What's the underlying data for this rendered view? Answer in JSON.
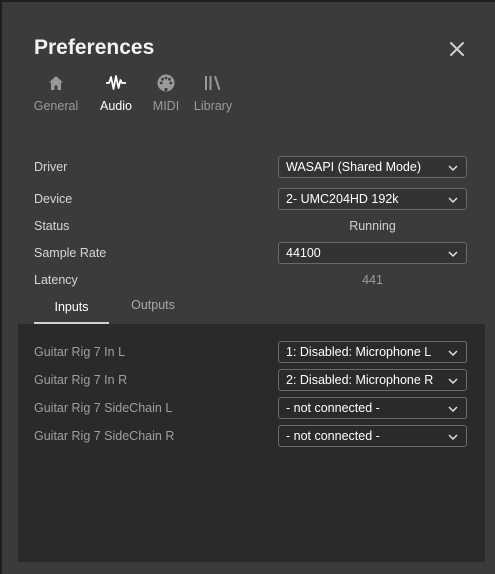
{
  "dialog": {
    "title": "Preferences"
  },
  "tabs": [
    {
      "label": "General",
      "icon": "home-icon",
      "active": false
    },
    {
      "label": "Audio",
      "icon": "waveform-icon",
      "active": true
    },
    {
      "label": "MIDI",
      "icon": "midi-connector-icon",
      "active": false
    },
    {
      "label": "Library",
      "icon": "library-icon",
      "active": false
    }
  ],
  "audio": {
    "driver": {
      "label": "Driver",
      "value": "WASAPI (Shared Mode)"
    },
    "device": {
      "label": "Device",
      "value": "2- UMC204HD 192k"
    },
    "status": {
      "label": "Status",
      "value": "Running"
    },
    "sample_rate": {
      "label": "Sample Rate",
      "value": "44100"
    },
    "latency": {
      "label": "Latency",
      "value": "441"
    }
  },
  "subtabs": [
    {
      "label": "Inputs",
      "active": true
    },
    {
      "label": "Outputs",
      "active": false
    }
  ],
  "inputs": [
    {
      "label": "Guitar Rig 7 In L",
      "value": "1: Disabled: Microphone L"
    },
    {
      "label": "Guitar Rig 7 In R",
      "value": "2: Disabled: Microphone R"
    },
    {
      "label": "Guitar Rig 7 SideChain L",
      "value": "- not connected -"
    },
    {
      "label": "Guitar Rig 7 SideChain R",
      "value": "- not connected -"
    }
  ],
  "colors": {
    "dialog_bg": "#3b3b3b",
    "panel_bg": "#2a2a2a",
    "active_text": "#ffffff",
    "inactive_text": "#9a9a9a"
  }
}
